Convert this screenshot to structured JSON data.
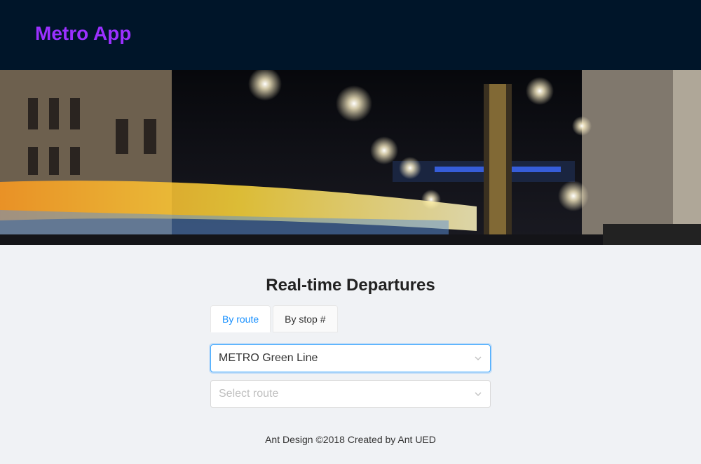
{
  "header": {
    "logo_text": "Metro App"
  },
  "banner": {
    "image": "night-city-street-with-light-trails"
  },
  "main": {
    "title": "Real-time Departures",
    "tabs": [
      {
        "label": "By route",
        "active": true
      },
      {
        "label": "By stop #",
        "active": false
      }
    ],
    "route_select": {
      "value": "METRO Green Line"
    },
    "direction_select": {
      "placeholder": "Select route"
    }
  },
  "footer": {
    "text": "Ant Design ©2018 Created by Ant UED"
  },
  "colors": {
    "header_bg": "#001529",
    "logo": "#9b30ff",
    "accent": "#1890ff",
    "page_bg": "#f0f2f5"
  }
}
